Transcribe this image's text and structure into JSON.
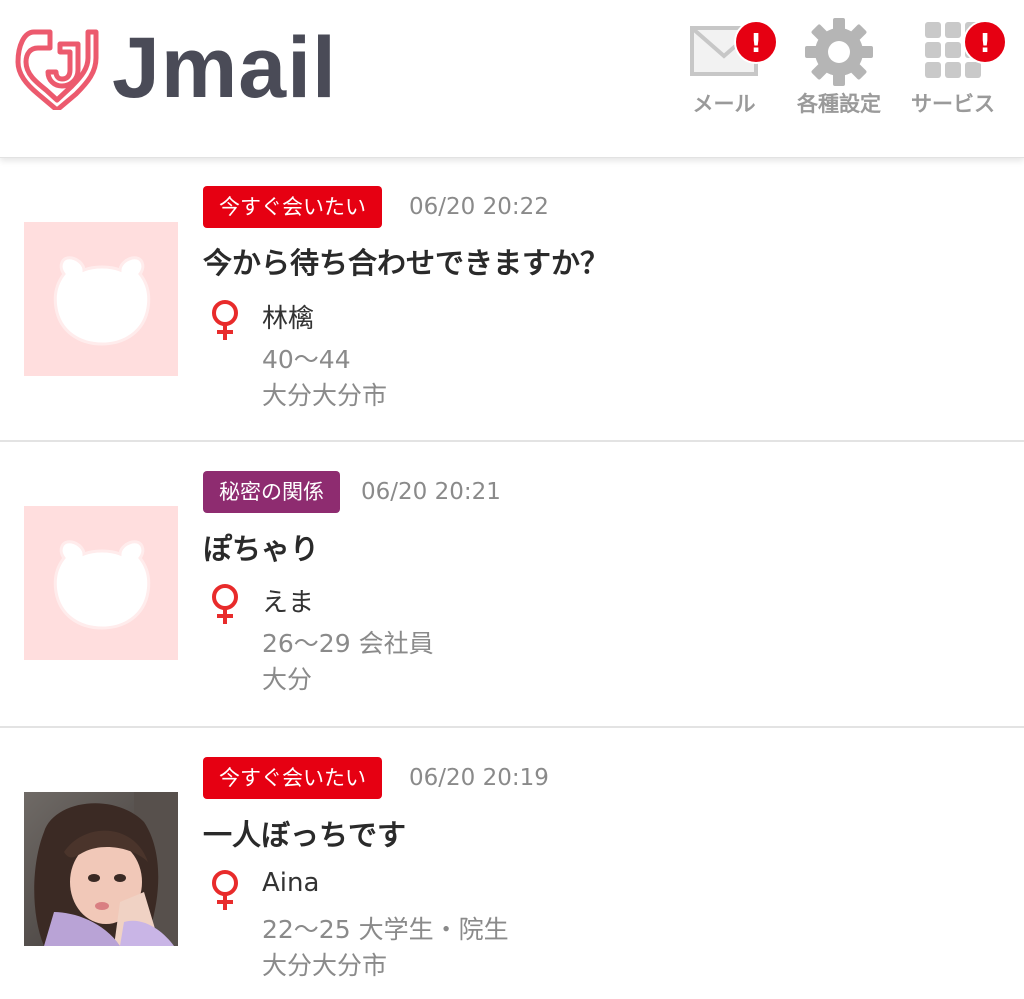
{
  "header": {
    "logo_text": "Jmail",
    "nav": [
      {
        "label": "メール",
        "icon": "mail-icon",
        "badge": "!"
      },
      {
        "label": "各種設定",
        "icon": "gear-icon"
      },
      {
        "label": "サービス",
        "icon": "grid-icon",
        "badge": "!"
      }
    ]
  },
  "colors": {
    "tag_red": "#e60012",
    "tag_purple": "#8e2c70",
    "logo_pink": "#ec5a6e",
    "placeholder_bg": "#ffdede",
    "female_symbol": "#e82b2b"
  },
  "posts": [
    {
      "tag": "今すぐ会いたい",
      "time": "06/20 20:22",
      "title": "今から待ち合わせできますか？",
      "gender_icon": "female-icon",
      "name": "林檎",
      "age_job": "40〜44",
      "location": "大分大分市",
      "avatar": "placeholder-bear-icon"
    },
    {
      "tag": "秘密の関係",
      "time": "06/20 20:21",
      "title": "ぽちゃり",
      "gender_icon": "female-icon",
      "name": "えま",
      "age_job": "26〜29 会社員",
      "location": "大分",
      "avatar": "placeholder-bear-icon"
    },
    {
      "tag": "今すぐ会いたい",
      "time": "06/20 20:19",
      "title": "一人ぼっちです",
      "gender_icon": "female-icon",
      "name": "Aina",
      "age_job": "22〜25 大学生・院生",
      "location": "大分大分市",
      "avatar": "profile-photo"
    }
  ]
}
